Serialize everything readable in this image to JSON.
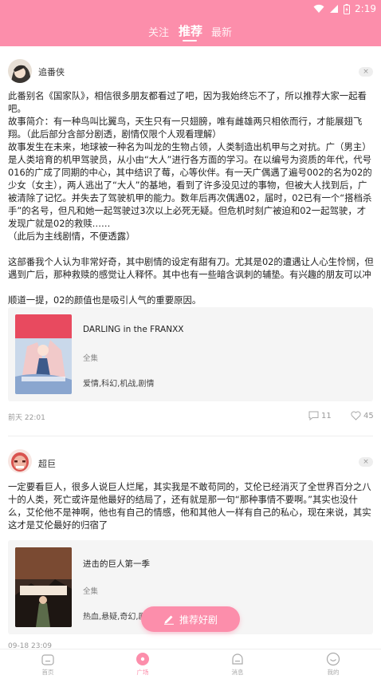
{
  "status_bar": {
    "time": "2:19"
  },
  "header": {
    "tabs": [
      {
        "label": "关注",
        "active": false
      },
      {
        "label": "推荐",
        "active": true
      },
      {
        "label": "最新",
        "active": false
      }
    ]
  },
  "posts": [
    {
      "author": "追番侠",
      "close_label": "×",
      "text": "此番别名《国家队》，相信很多朋友都看过了吧，因为我始终忘不了，所以推荐大家一起看吧。\n故事简介：有一种鸟叫比翼鸟，天生只有一只翅膀，唯有雌雄两只相依而行，才能展翅飞翔。（此后部分含部分剧透，剧情仅限个人观看理解）\n故事发生在未来，地球被一种名为叫龙的生物占领，人类制造出机甲与之对抗。广（男主）是人类培育的机甲驾驶员，从小由“大人”进行各方面的学习。在以编号为资质的年代，代号016的广成了同期的中心，其中结识了莓，心等伙伴。有一天广偶遇了遍号002的名为02的少女（女主），两人逃出了“大人”的基地，看到了许多没见过的事物，但被大人找到后，广被清除了记忆。并失去了驾驶机甲的能力。数年后再次偶遇02，届时，02已有一个“搭档杀手”的名号，但凡和她一起驾驶过3次以上必死无疑。但危机时刻广被迫和02一起驾驶，才发现广就是02的救赎……\n（此后为主线剧情，不便透露）\n\n这部番我个人认为非常好奇，其中剧情的设定有甜有刀。尤其是02的遭遇让人心生怜悯，但遇到广后，那种救赎的感觉让人释怀。其中也有一些暗含讽刺的辅垫。有兴趣的朋友可以冲\n\n顺道一提，02的颜值也是吸引人气的重要原因。",
      "card": {
        "title": "DARLING in the FRANXX",
        "subtitle": "全集",
        "tags": "爱情,科幻,机战,剧情"
      },
      "time": "前天 22:01",
      "comments": "11",
      "likes": "45"
    },
    {
      "author": "超巨",
      "close_label": "×",
      "text": "一定要看巨人，很多人说巨人烂尾，其实我是不敢苟同的，艾伦已经消灭了全世界百分之八十的人类，死亡或许是他最好的结局了，还有就是那一句“那种事情不要啊。”其实也没什么，艾伦他不是神啊，他也有自己的情感，他和其他人一样有自己的私心，现在来说，其实这才是艾伦最好的归宿了",
      "card": {
        "title": "进击的巨人第一季",
        "subtitle": "全集",
        "tags": "热血,悬疑,奇幻,剧情"
      },
      "time": "09-18 23:09",
      "comments": "",
      "likes": ""
    }
  ],
  "fab": {
    "label": "推荐好剧"
  },
  "bottom_nav": [
    {
      "label": "首页",
      "icon": "home-icon",
      "active": false
    },
    {
      "label": "广场",
      "icon": "plaza-icon",
      "active": true
    },
    {
      "label": "消息",
      "icon": "message-icon",
      "active": false
    },
    {
      "label": "我的",
      "icon": "profile-icon",
      "active": false
    }
  ],
  "colors": {
    "brand_pink": "#fc8eab",
    "card_bg": "#f5f5f5",
    "muted_text": "#999999"
  }
}
